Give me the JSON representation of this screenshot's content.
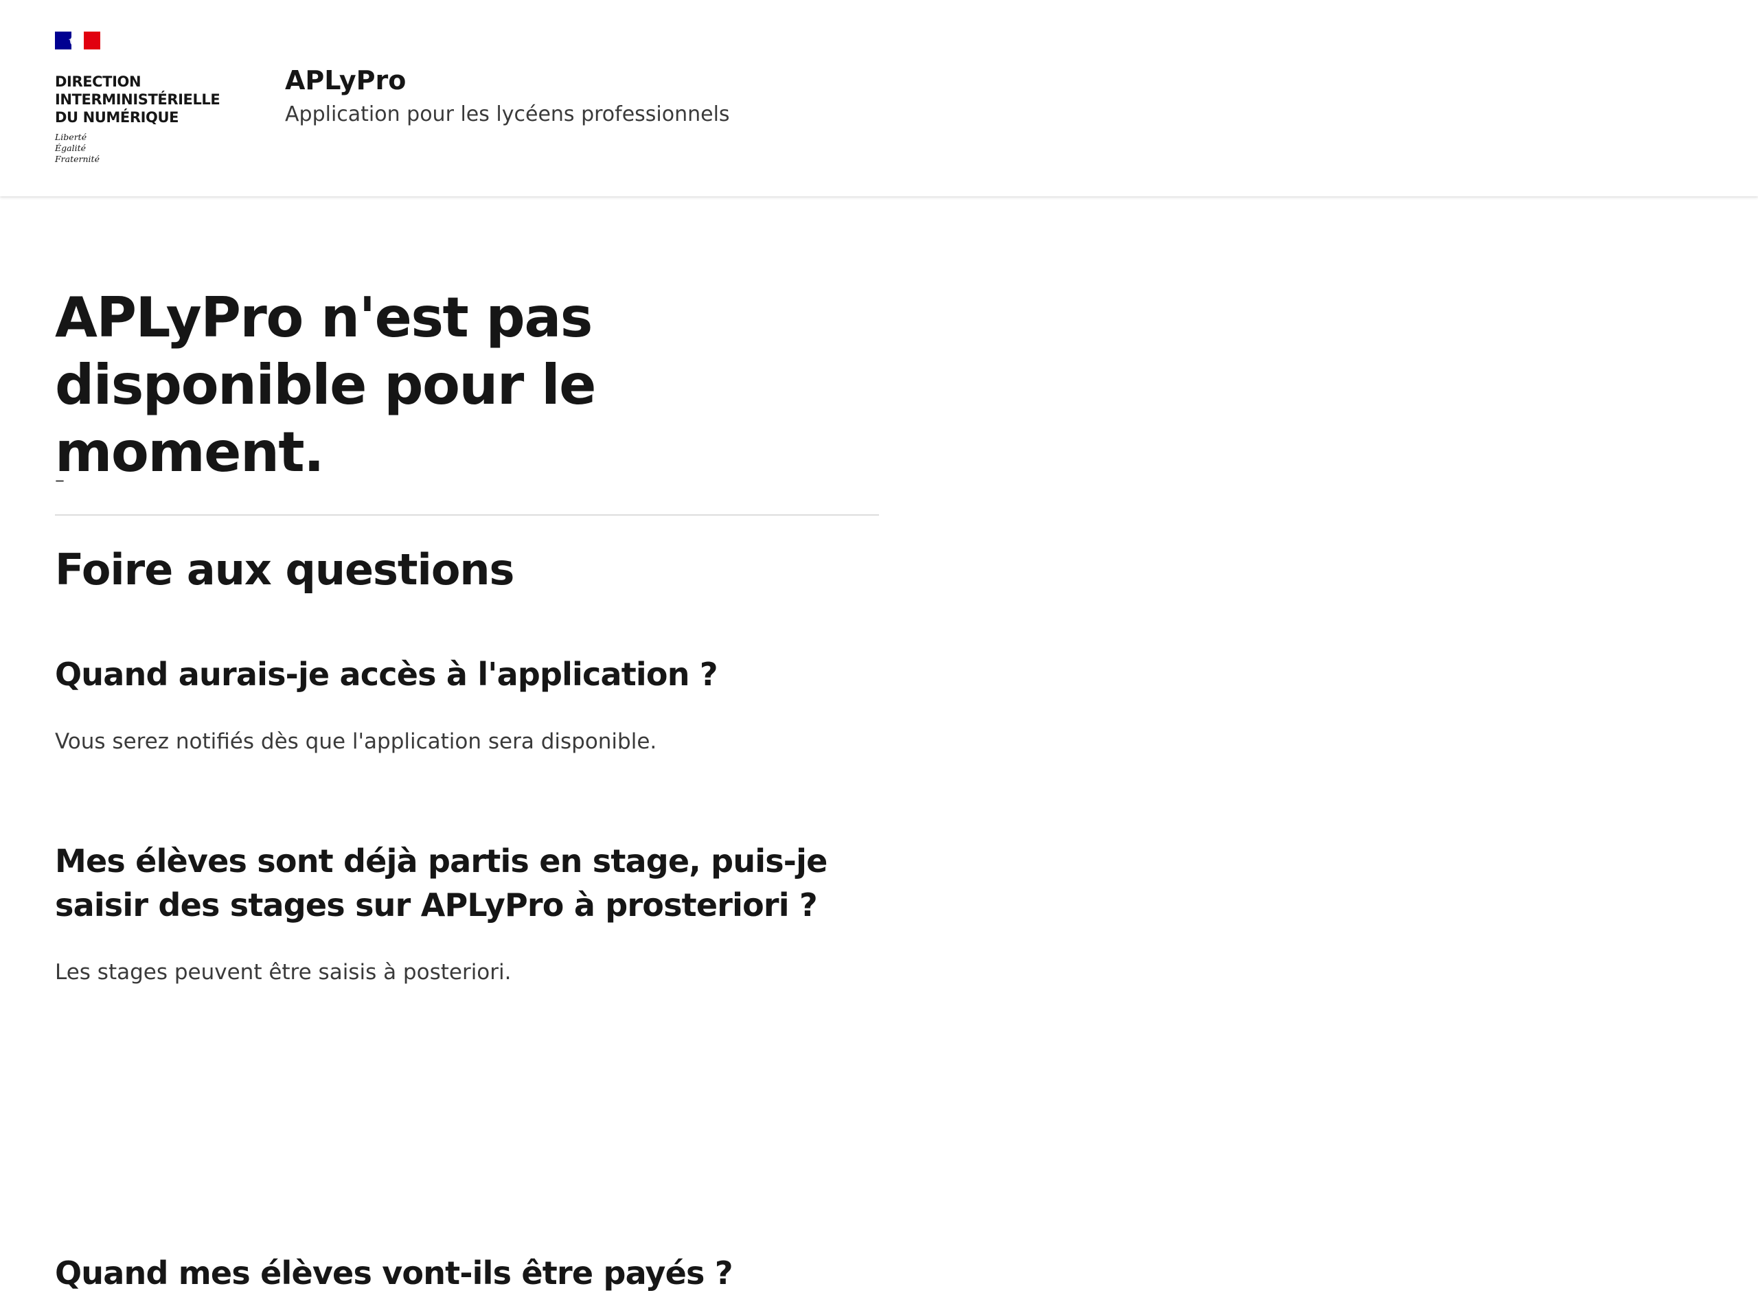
{
  "header": {
    "flag_colors": {
      "blue": "#000091",
      "white": "#ffffff",
      "red": "#e1000f"
    },
    "flag_icon": "marianne-flag-icon",
    "institution_lines": [
      "DIRECTION",
      "INTERMINISTÉRIELLE",
      "DU NUMÉRIQUE"
    ],
    "motto_lines": [
      "Liberté",
      "Égalité",
      "Fraternité"
    ],
    "service_title": "APLyPro",
    "service_tagline": "Application pour les lycéens professionnels"
  },
  "main": {
    "title": "APLyPro n'est pas disponible pour le moment.",
    "subtitle": "–",
    "faq": {
      "title": "Foire aux questions",
      "items": [
        {
          "question": "Quand aurais-je accès à l'application ?",
          "answer": "Vous serez notifiés dès que l'application sera disponible."
        },
        {
          "question": "Mes élèves sont déjà partis en stage, puis-je saisir des stages sur APLyPro à prosteriori ?",
          "answer": "Les stages peuvent être saisis à posteriori."
        },
        {
          "question": "Quand mes élèves vont-ils être payés ?"
        }
      ]
    }
  }
}
